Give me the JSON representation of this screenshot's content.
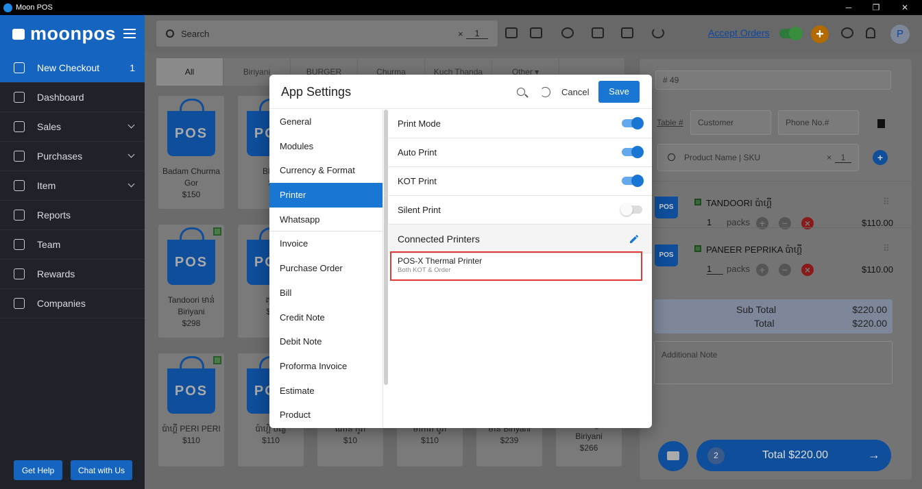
{
  "window": {
    "title": "Moon POS",
    "controls": [
      "─",
      "❐",
      "✕"
    ]
  },
  "brand": {
    "name": "moonpos"
  },
  "sidebar": {
    "items": [
      {
        "label": "New Checkout",
        "count": "1"
      },
      {
        "label": "Dashboard"
      },
      {
        "label": "Sales"
      },
      {
        "label": "Purchases"
      },
      {
        "label": "Item"
      },
      {
        "label": "Reports"
      },
      {
        "label": "Team"
      },
      {
        "label": "Rewards"
      },
      {
        "label": "Companies"
      }
    ],
    "get_help": "Get Help",
    "chat": "Chat with Us"
  },
  "topbar": {
    "search_placeholder": "Search",
    "qty": "1",
    "clear": "×",
    "accept_orders": "Accept Orders",
    "avatar": "P"
  },
  "categories": [
    "All",
    "Biriyani",
    "BURGER",
    "Churma",
    "Kuch Thanda",
    "Other ▾"
  ],
  "products": [
    {
      "name": "Badam Churma Gor",
      "price": "$150"
    },
    {
      "name": "Blue",
      "price": "$"
    },
    {
      "name": "Tandoori មាន់ Biriyani",
      "price": "$298"
    },
    {
      "name": "គុជ",
      "price": "$1"
    },
    {
      "name": "ប៉ាហ្គី PERI PERI",
      "price": "$110"
    },
    {
      "name": "ប៉ាហ្គី បន្លែ",
      "price": "$110"
    },
    {
      "name": "ណាន់ កូរ៉ា",
      "price": "$10"
    },
    {
      "name": "មាការ៉ា ប៊ូរ៉ា",
      "price": "$110"
    },
    {
      "name": "មាន់ Biriyani",
      "price": "$239"
    },
    {
      "name": "មាន់ Mughal Biriyani",
      "price": "$266"
    }
  ],
  "pos_label": "POS",
  "cart": {
    "order_no": "# 49",
    "table": "Table #",
    "customer": "Customer",
    "phone": "Phone No.#",
    "product_search": "Product Name | SKU",
    "qty": "1",
    "items": [
      {
        "name": "TANDOORI ប៉ាហ្គី",
        "qty": "1",
        "unit": "packs",
        "price": "$110.00"
      },
      {
        "name": "PANEER PEPRIKA ប៉ាហ្គី",
        "qty": "1",
        "unit": "packs",
        "price": "$110.00"
      }
    ],
    "subtotal_label": "Sub Total",
    "subtotal": "$220.00",
    "total_label": "Total",
    "total": "$220.00",
    "note_placeholder": "Additional Note",
    "badge": "2",
    "total_button": "Total $220.00"
  },
  "modal": {
    "title": "App Settings",
    "cancel": "Cancel",
    "save": "Save",
    "nav": [
      "General",
      "Modules",
      "Currency & Format",
      "Printer",
      "Whatsapp",
      "Invoice",
      "Purchase Order",
      "Bill",
      "Credit Note",
      "Debit Note",
      "Proforma Invoice",
      "Estimate",
      "Product"
    ],
    "active_nav": "Printer",
    "settings": [
      {
        "label": "Print Mode",
        "on": true
      },
      {
        "label": "Auto Print",
        "on": true
      },
      {
        "label": "KOT Print",
        "on": true
      },
      {
        "label": "Silent Print",
        "on": false
      }
    ],
    "connected_header": "Connected Printers",
    "printer": {
      "name": "POS-X Thermal Printer",
      "sub": "Both KOT & Order"
    }
  },
  "colors": {
    "accent": "#1976d2",
    "sidebar": "#1f2329",
    "highlight": "#e53935"
  }
}
